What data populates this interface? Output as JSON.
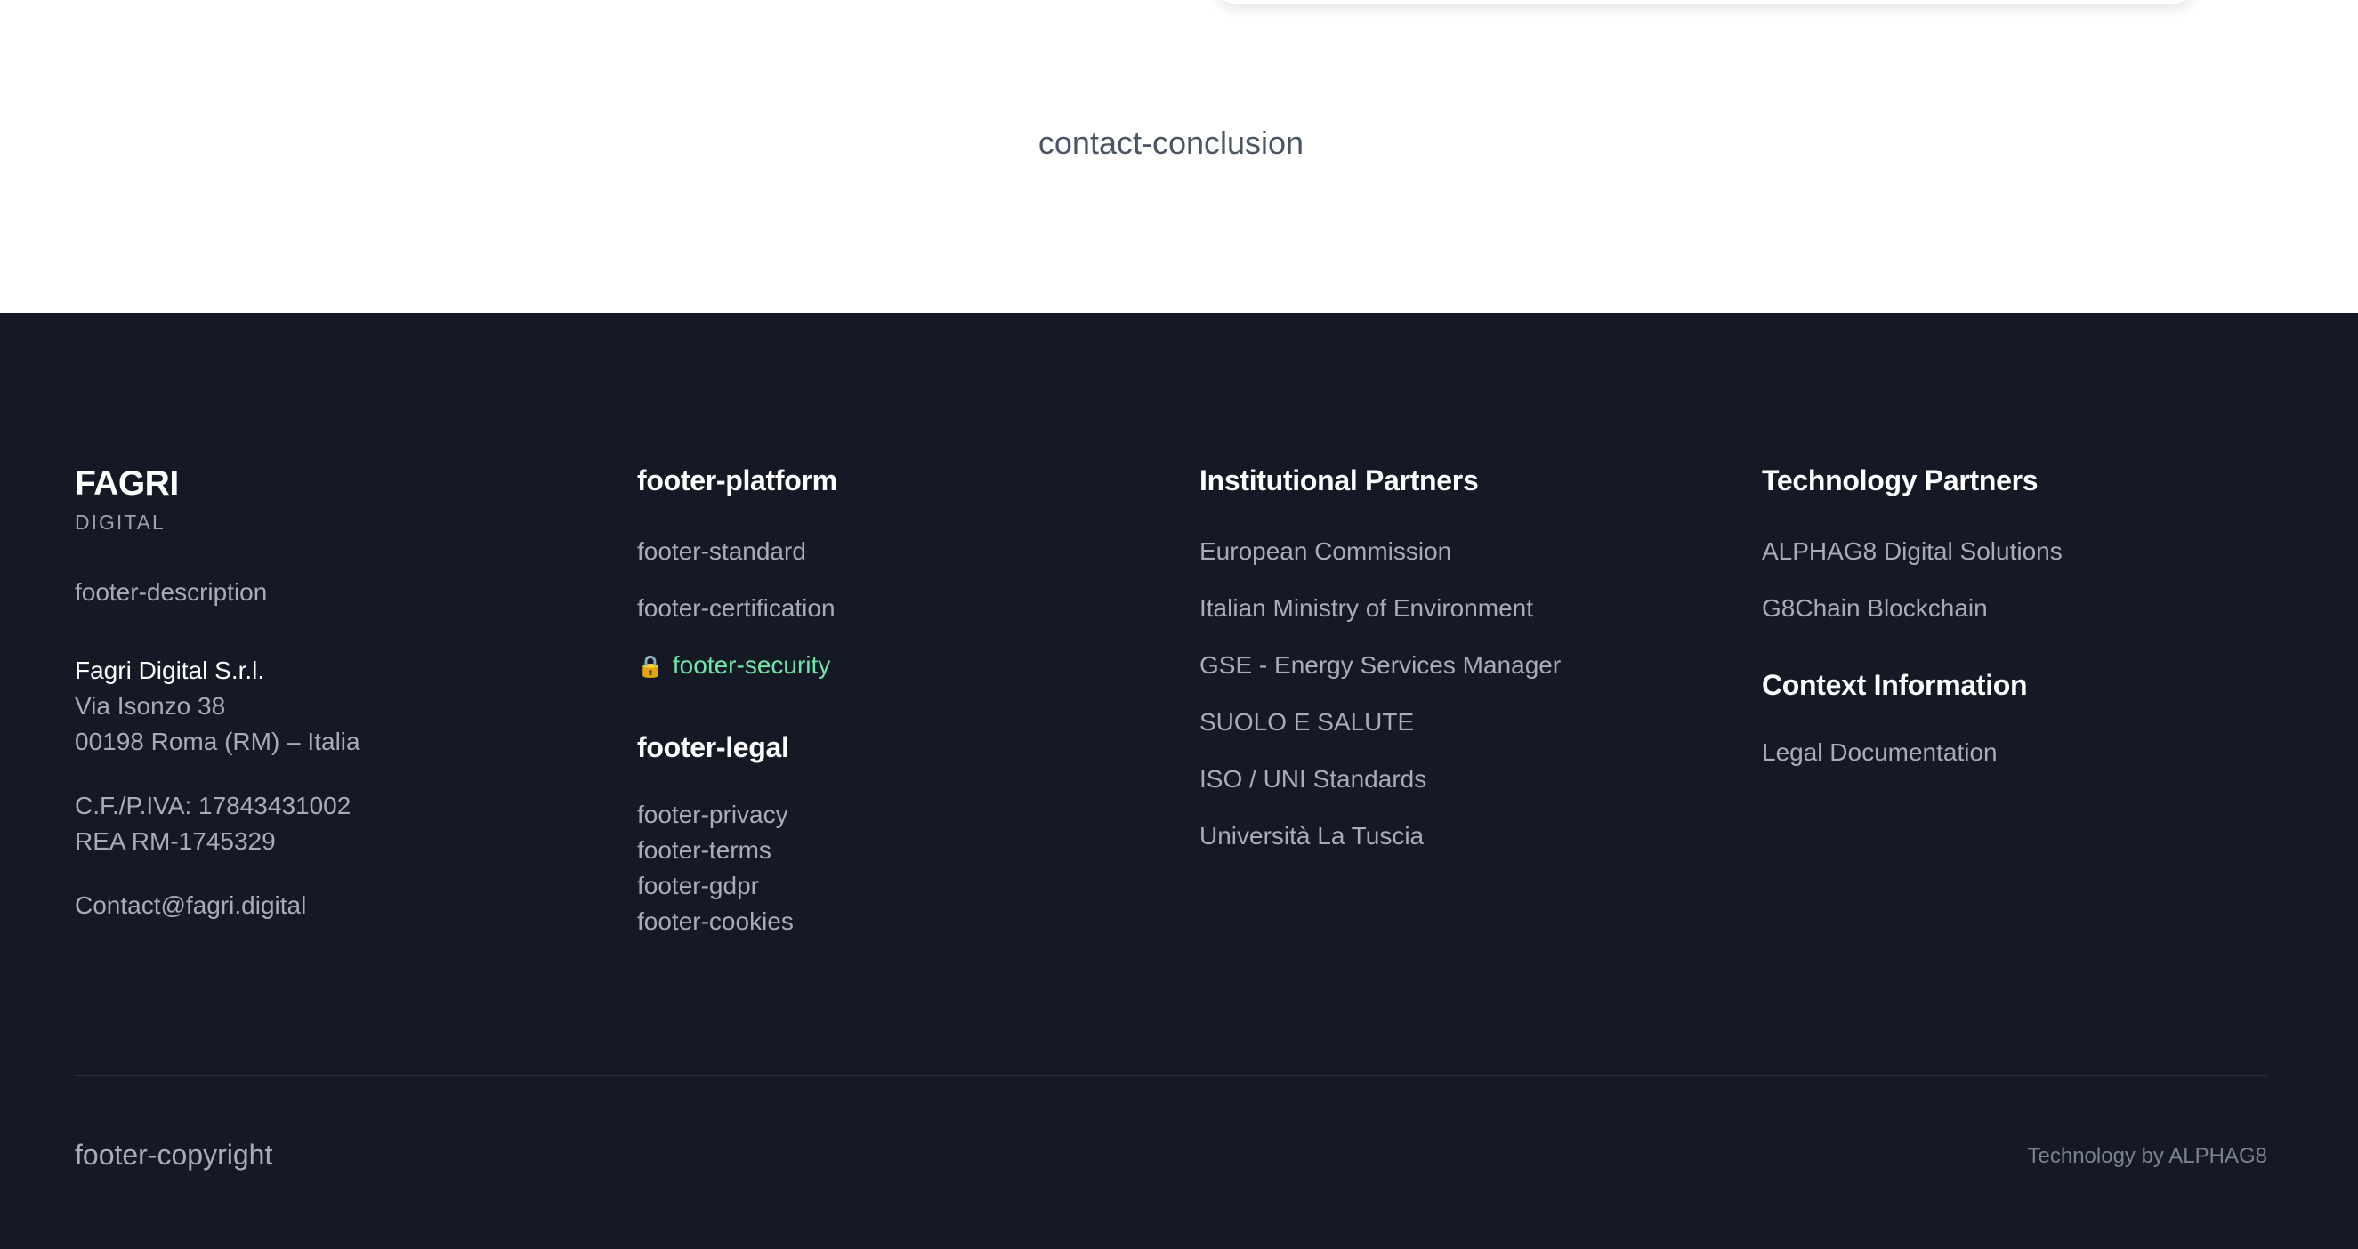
{
  "contact": {
    "conclusion": "contact-conclusion"
  },
  "brand": {
    "name": "FAGRI",
    "subtitle": "DIGITAL",
    "description": "footer-description"
  },
  "company": {
    "name": "Fagri Digital S.r.l.",
    "address_line1": "Via Isonzo 38",
    "address_line2": "00198 Roma (RM) – Italia",
    "tax_id": "C.F./P.IVA: 17843431002",
    "rea": "REA RM-1745329",
    "email": "Contact@fagri.digital"
  },
  "platform": {
    "heading": "footer-platform",
    "items": [
      {
        "label": "footer-standard"
      },
      {
        "label": "footer-certification"
      },
      {
        "label": "footer-security",
        "icon": "lock-icon"
      }
    ]
  },
  "legal": {
    "heading": "footer-legal",
    "items": [
      {
        "label": "footer-privacy"
      },
      {
        "label": "footer-terms"
      },
      {
        "label": "footer-gdpr"
      },
      {
        "label": "footer-cookies"
      }
    ]
  },
  "institutional": {
    "heading": "Institutional Partners",
    "items": [
      {
        "label": "European Commission"
      },
      {
        "label": "Italian Ministry of Environment"
      },
      {
        "label": "GSE - Energy Services Manager"
      },
      {
        "label": "SUOLO E SALUTE"
      },
      {
        "label": "ISO / UNI Standards"
      },
      {
        "label": "Università La Tuscia"
      }
    ]
  },
  "technology": {
    "heading": "Technology Partners",
    "items": [
      {
        "label": "ALPHAG8 Digital Solutions"
      },
      {
        "label": "G8Chain Blockchain"
      }
    ]
  },
  "context": {
    "heading": "Context Information",
    "items": [
      {
        "label": "Legal Documentation"
      }
    ]
  },
  "bottom": {
    "copyright": "footer-copyright",
    "tech_by": "Technology by ALPHAG8"
  },
  "colors": {
    "footer_bg": "#141925",
    "accent_green": "#6ee7a8",
    "link_gray": "#a7adb8"
  }
}
